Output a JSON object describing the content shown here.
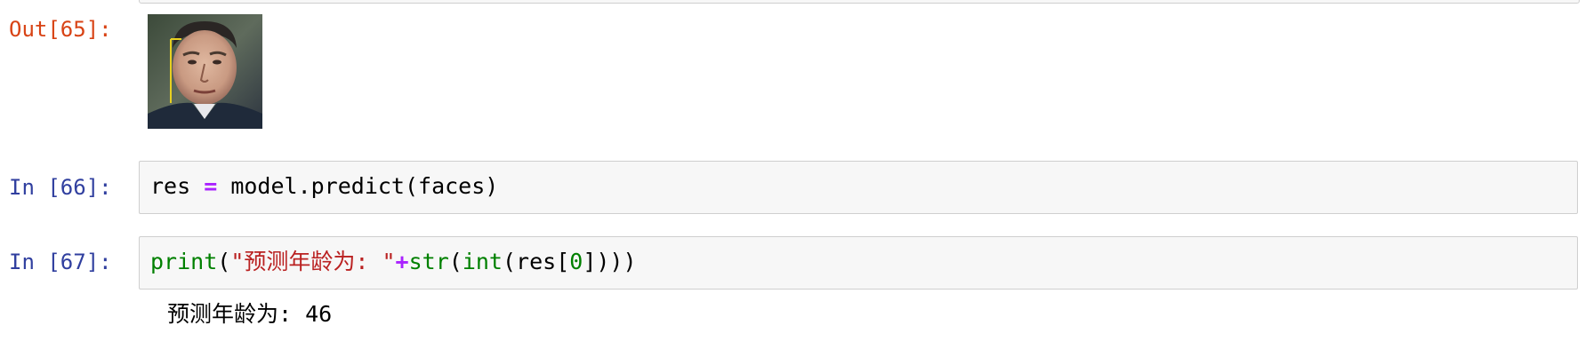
{
  "cells": {
    "out65": {
      "prompt": "Out[65]:"
    },
    "in66": {
      "prompt": "In [66]:",
      "code": {
        "var": "res",
        "op": " = ",
        "call": "model.predict(faces)"
      }
    },
    "in67": {
      "prompt": "In [67]:",
      "code": {
        "fn_print": "print",
        "open_paren": "(",
        "string": "\"预测年龄为: \"",
        "plus": "+",
        "fn_str": "str",
        "paren_str": "(",
        "fn_int": "int",
        "paren_int": "(res[",
        "index": "0",
        "close": "])))"
      },
      "stdout": "预测年龄为: 46"
    }
  },
  "colors": {
    "out_prompt": "#d84315",
    "in_prompt": "#303f9f",
    "keyword_green": "#008000",
    "string_red": "#ba2121",
    "operator_purple": "#aa22ff",
    "cell_bg": "#f7f7f7",
    "cell_border": "#cfcfcf"
  },
  "icons": {
    "output_image": "face-photo-with-detection-box"
  }
}
